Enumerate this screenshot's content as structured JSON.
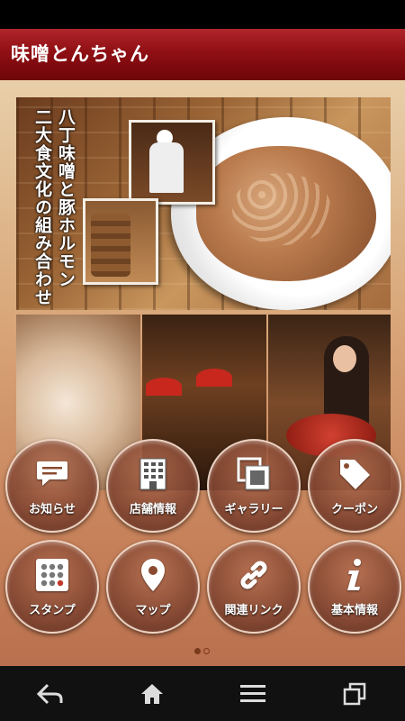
{
  "app": {
    "title": "味噌とんちゃん"
  },
  "banner": {
    "line1": "八丁味噌と豚ホルモン",
    "line2": "二大食文化の組み合わせ"
  },
  "menu": [
    {
      "label": "お知らせ",
      "icon": "chat-bubble-icon"
    },
    {
      "label": "店舗情報",
      "icon": "building-icon"
    },
    {
      "label": "ギャラリー",
      "icon": "gallery-icon"
    },
    {
      "label": "クーポン",
      "icon": "coupon-tag-icon"
    },
    {
      "label": "スタンプ",
      "icon": "stamp-grid-icon"
    },
    {
      "label": "マップ",
      "icon": "map-pin-icon"
    },
    {
      "label": "関連リンク",
      "icon": "link-chain-icon"
    },
    {
      "label": "基本情報",
      "icon": "info-icon"
    }
  ],
  "pager": {
    "pages": 2,
    "current": 1
  },
  "navbar": [
    "back-icon",
    "home-icon",
    "menu-icon",
    "recent-apps-icon"
  ],
  "colors": {
    "title_bar": "#8f0f14",
    "accent": "#7a3a1c"
  }
}
